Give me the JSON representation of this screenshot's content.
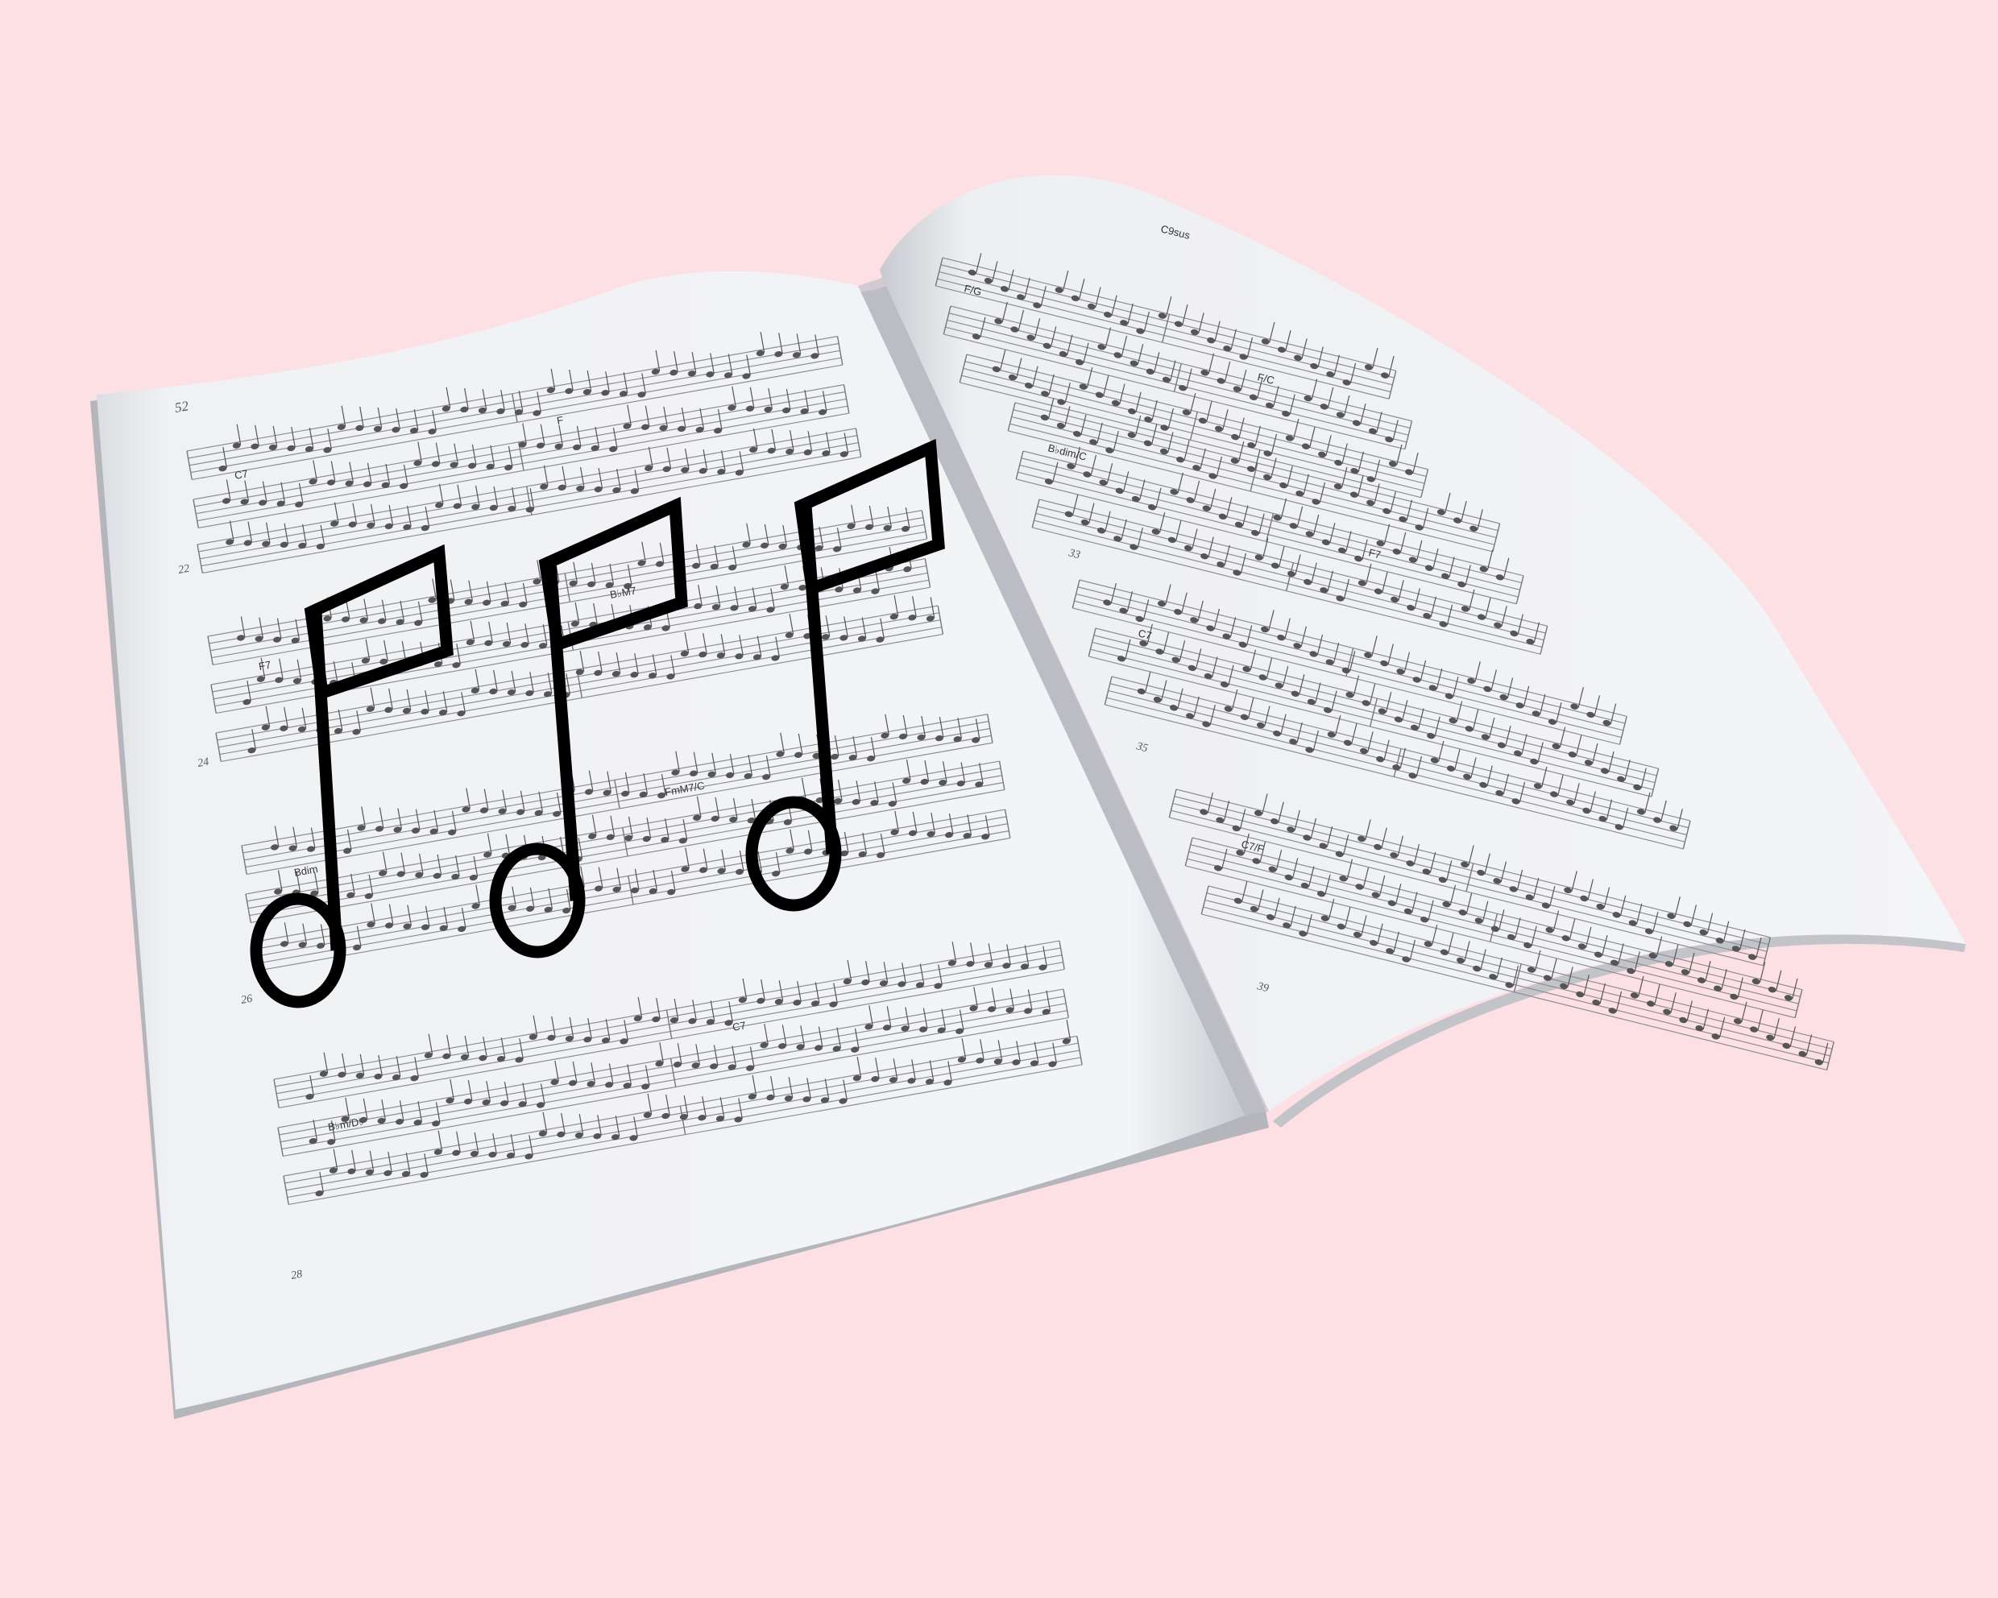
{
  "background_color": "#fde0e4",
  "book": {
    "left_page": {
      "page_number": "52",
      "measure_numbers": [
        "22",
        "24",
        "26",
        "28"
      ],
      "chords": [
        "C7",
        "F",
        "F7",
        "B♭M7",
        "Bdim",
        "FmM7/C",
        "C7",
        "B♭m/D♭"
      ]
    },
    "right_page": {
      "measure_numbers": [
        "33",
        "35",
        "39"
      ],
      "chords": [
        "F/G",
        "C9sus",
        "B♭dim/C",
        "F/C",
        "C7",
        "F7",
        "C7/F"
      ]
    }
  },
  "overlay": {
    "icon": "eighth-note-icon",
    "count": 3,
    "color": "#000000"
  }
}
